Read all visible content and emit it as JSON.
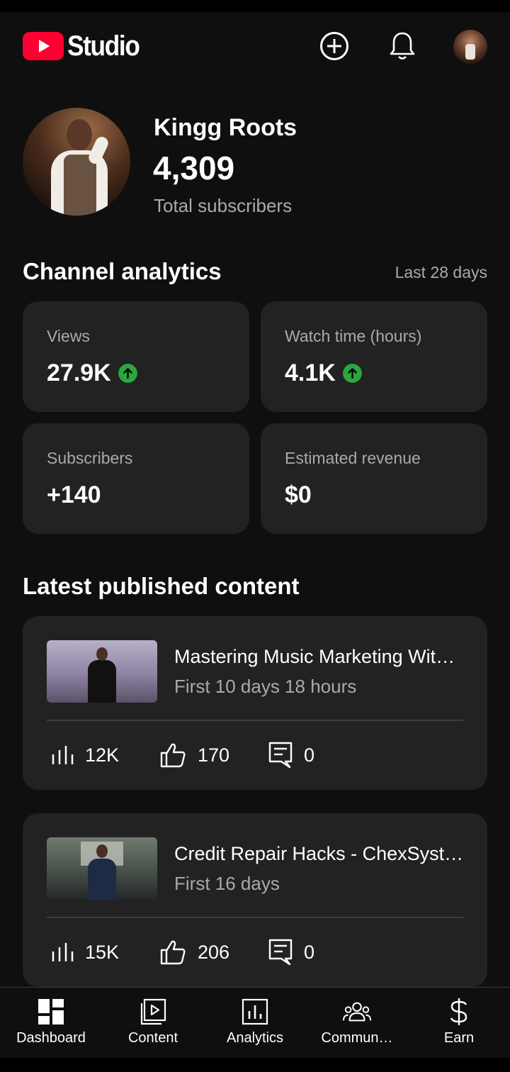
{
  "app": {
    "logo_text": "Studio",
    "accent": "#ff0033"
  },
  "header": {
    "create_icon": "add-circle-icon",
    "notifications_icon": "bell-icon"
  },
  "channel": {
    "name": "Kingg Roots",
    "subscriber_count": "4,309",
    "subscriber_label": "Total subscribers"
  },
  "analytics": {
    "title": "Channel analytics",
    "range": "Last 28 days",
    "trend_color": "#2ba640",
    "cards": [
      {
        "label": "Views",
        "value": "27.9K",
        "trend": "up"
      },
      {
        "label": "Watch time (hours)",
        "value": "4.1K",
        "trend": "up"
      },
      {
        "label": "Subscribers",
        "value": "+140",
        "trend": "none"
      },
      {
        "label": "Estimated revenue",
        "value": "$0",
        "trend": "none"
      }
    ]
  },
  "latest": {
    "title": "Latest published content",
    "videos": [
      {
        "title": "Mastering Music Marketing Wit…",
        "period": "First 10 days 18 hours",
        "views": "12K",
        "likes": "170",
        "comments": "0"
      },
      {
        "title": "Credit Repair Hacks - ChexSyst…",
        "period": "First 16 days",
        "views": "15K",
        "likes": "206",
        "comments": "0"
      }
    ]
  },
  "nav": {
    "items": [
      {
        "label": "Dashboard",
        "icon": "dashboard-icon"
      },
      {
        "label": "Content",
        "icon": "content-icon"
      },
      {
        "label": "Analytics",
        "icon": "analytics-icon"
      },
      {
        "label": "Commun…",
        "icon": "community-icon"
      },
      {
        "label": "Earn",
        "icon": "dollar-icon"
      }
    ]
  }
}
